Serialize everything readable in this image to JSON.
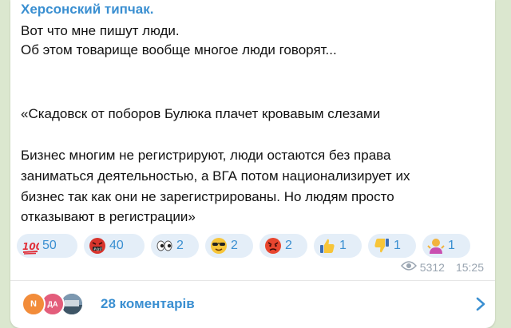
{
  "post": {
    "channel_name": "Херсонский типчак.",
    "lines": [
      "Вот что мне пишут люди.",
      "Об этом товарище вообще многое люди говорят...",
      "«Скадовск от поборов Булюка плачет кровавым слезами",
      "Бизнес многим не регистрируют, люди остаются без права",
      "заниматься деятельностью, а ВГА потом национализирует их",
      "бизнес так как они не зарегистрированы. Но людям просто",
      "отказывают в регистрации»"
    ]
  },
  "reactions": [
    {
      "icon": "hundred-points-icon",
      "count": "50"
    },
    {
      "icon": "angry-swearing-face-icon",
      "count": "40"
    },
    {
      "icon": "eyes-icon",
      "count": "2"
    },
    {
      "icon": "sunglasses-face-icon",
      "count": "2"
    },
    {
      "icon": "angry-face-icon",
      "count": "2"
    },
    {
      "icon": "thumbs-up-icon",
      "count": "1"
    },
    {
      "icon": "thumbs-down-icon",
      "count": "1"
    },
    {
      "icon": "person-shrugging-icon",
      "count": "1"
    }
  ],
  "meta": {
    "views": "5312",
    "time": "15:25"
  },
  "comments": {
    "avatars": [
      {
        "initial": "N",
        "color": "#f28c3a"
      },
      {
        "initial": "ДА",
        "color": "#e35d7b"
      },
      {
        "initial": "",
        "color": "#5f7f99"
      }
    ],
    "label": "28 коментарів"
  }
}
